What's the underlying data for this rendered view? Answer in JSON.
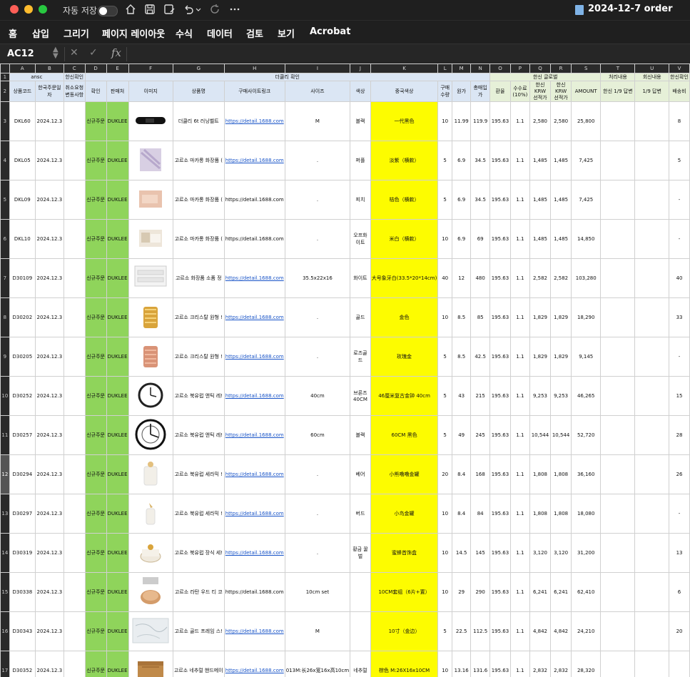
{
  "titlebar": {
    "autosave_label": "자동 저장",
    "doc_title": "2024-12-7 order",
    "chevron": "⌄"
  },
  "menu": [
    "홈",
    "삽입",
    "그리기",
    "페이지 레이아웃",
    "수식",
    "데이터",
    "검토",
    "보기",
    "Acrobat"
  ],
  "formula": {
    "cell_ref": "AC12",
    "fx_label": "fx",
    "value": ""
  },
  "columns": [
    "A",
    "B",
    "C",
    "D",
    "E",
    "F",
    "G",
    "H",
    "I",
    "J",
    "K",
    "L",
    "M",
    "N",
    "O",
    "P",
    "Q",
    "R",
    "S",
    "T",
    "U",
    "V"
  ],
  "groups": {
    "ansc": "ansc",
    "hanshin_confirm": "한신확인",
    "dukley_confirm": "더쿨리 확인",
    "hanshin_global": "한신 글로벌",
    "processing": "처리내용",
    "reply": "회신내용",
    "hanshin_confirm2": "한신확인"
  },
  "headers": {
    "A": "상품코드",
    "B": "한국주문일자",
    "C": "취소요청\n변동사항",
    "D": "확인",
    "E": "판매처",
    "F": "이미지",
    "G": "상품명",
    "H": "구매사이트링크",
    "I": "사이즈",
    "J": "색상",
    "K": "중국색상",
    "L": "구매\n수량",
    "M": "원가",
    "N": "총매입가",
    "O": "환율",
    "P": "수수료\n(10%)",
    "Q": "한신KRW\n선적가",
    "R": "한신KRW\n선적가",
    "S": "AMOUNT",
    "T": "한신 1/9 답변",
    "U": "1/9 답변",
    "V": "배송비"
  },
  "rows": [
    {
      "num": "3",
      "code": "DKL60",
      "date": "2024.12.3",
      "confirm": "신규주문",
      "seller": "DUKLEE",
      "name": "더쿨리 6t 러닝벨트",
      "link": "https://detail.1688.com",
      "size": "M",
      "color": "블랙",
      "cn_color": "一代黑色",
      "qty": "10",
      "cost": "11.99",
      "total": "119.9",
      "rate": "195.63",
      "fee": "1.1",
      "krw1": "2,580",
      "krw2": "2,580",
      "amount": "25,800",
      "ship": "8",
      "link_u": true,
      "thumb": "belt"
    },
    {
      "num": "4",
      "code": "DKL05",
      "date": "2024.12.3",
      "confirm": "신규주문",
      "seller": "DUKLEE",
      "name": "고르소 마카롱 화장품 (",
      "link": "https://detail.1688.com",
      "size": ".",
      "color": "퍼플",
      "cn_color": "淡紫（横款）",
      "qty": "5",
      "cost": "6.9",
      "total": "34.5",
      "rate": "195.63",
      "fee": "1.1",
      "krw1": "1,485",
      "krw2": "1,485",
      "amount": "7,425",
      "ship": "5",
      "link_u": true,
      "thumb": "pouch-purple"
    },
    {
      "num": "5",
      "code": "DKL09",
      "date": "2024.12.3",
      "confirm": "신규주문",
      "seller": "DUKLEE",
      "name": "고르소 마카롱 화장품 (",
      "link": "https://detail.1688.com",
      "size": ".",
      "color": "피치",
      "cn_color": "桔色（横款）",
      "qty": "5",
      "cost": "6.9",
      "total": "34.5",
      "rate": "195.63",
      "fee": "1.1",
      "krw1": "1,485",
      "krw2": "1,485",
      "amount": "7,425",
      "ship": "-",
      "link_u": false,
      "thumb": "pouch-peach"
    },
    {
      "num": "6",
      "code": "DKL10",
      "date": "2024.12.3",
      "confirm": "신규주문",
      "seller": "DUKLEE",
      "name": "고르소 마카롱 화장품 (",
      "link": "https://detail.1688.com",
      "size": ".",
      "color": "오프화이트",
      "cn_color": "米白（横款）",
      "qty": "10",
      "cost": "6.9",
      "total": "69",
      "rate": "195.63",
      "fee": "1.1",
      "krw1": "1,485",
      "krw2": "1,485",
      "amount": "14,850",
      "ship": "-",
      "link_u": false,
      "thumb": "pouch-white"
    },
    {
      "num": "7",
      "code": "D30109",
      "date": "2024.12.3",
      "confirm": "신규주문",
      "seller": "DUKLEE",
      "name": "고르소 화장품 소품 정",
      "link": "https://detail.1688.com",
      "size": "35.5x22x16",
      "color": "화이트",
      "cn_color": "大号象牙白(33.5*20*14cm)",
      "qty": "40",
      "cost": "12",
      "total": "480",
      "rate": "195.63",
      "fee": "1.1",
      "krw1": "2,582",
      "krw2": "2,582",
      "amount": "103,280",
      "ship": "40",
      "link_u": true,
      "thumb": "organizer"
    },
    {
      "num": "8",
      "code": "D30202",
      "date": "2024.12.3",
      "confirm": "신규주문",
      "seller": "DUKLEE",
      "name": "고르소 크리스탈 원형 !",
      "link": "https://detail.1688.com",
      "size": ".",
      "color": "골드",
      "cn_color": "金色",
      "qty": "10",
      "cost": "8.5",
      "total": "85",
      "rate": "195.63",
      "fee": "1.1",
      "krw1": "1,829",
      "krw2": "1,829",
      "amount": "18,290",
      "ship": "33",
      "link_u": true,
      "thumb": "crystal-gold"
    },
    {
      "num": "9",
      "code": "D30205",
      "date": "2024.12.3",
      "confirm": "신규주문",
      "seller": "DUKLEE",
      "name": "고르소 크리스탈 원형 !",
      "link": "https://detail.1688.com",
      "size": ".",
      "color": "로즈골드",
      "cn_color": "玫瑰金",
      "qty": "5",
      "cost": "8.5",
      "total": "42.5",
      "rate": "195.63",
      "fee": "1.1",
      "krw1": "1,829",
      "krw2": "1,829",
      "amount": "9,145",
      "ship": "-",
      "link_u": true,
      "thumb": "crystal-rose"
    },
    {
      "num": "10",
      "code": "D30252",
      "date": "2024.12.3",
      "confirm": "신규주문",
      "seller": "DUKLEE",
      "name": "고르소 북유럽 앤틱 레!",
      "link": "https://detail.1688.com",
      "size": "40cm",
      "color": "브론즈\n40CM",
      "cn_color": "46厘米复古金钟 40cm",
      "qty": "5",
      "cost": "43",
      "total": "215",
      "rate": "195.63",
      "fee": "1.1",
      "krw1": "9,253",
      "krw2": "9,253",
      "amount": "46,265",
      "ship": "15",
      "link_u": true,
      "thumb": "clock"
    },
    {
      "num": "11",
      "code": "D30257",
      "date": "2024.12.3",
      "confirm": "신규주문",
      "seller": "DUKLEE",
      "name": "고르소 북유럽 앤틱 레!",
      "link": "https://detail.1688.com",
      "size": "60cm",
      "color": "블랙",
      "cn_color": "60CM 黑色",
      "qty": "5",
      "cost": "49",
      "total": "245",
      "rate": "195.63",
      "fee": "1.1",
      "krw1": "10,544",
      "krw2": "10,544",
      "amount": "52,720",
      "ship": "28",
      "link_u": true,
      "thumb": "clock2"
    },
    {
      "num": "12",
      "code": "D30294",
      "date": "2024.12.3",
      "confirm": "신규주문",
      "seller": "DUKLEE",
      "name": "고르소 북유럽 세라믹 !",
      "link": "https://detail.1688.com",
      "size": ".",
      "color": "베어",
      "cn_color": "小熊噜噜金罐",
      "qty": "20",
      "cost": "8.4",
      "total": "168",
      "rate": "195.63",
      "fee": "1.1",
      "krw1": "1,808",
      "krw2": "1,808",
      "amount": "36,160",
      "ship": "26",
      "link_u": true,
      "thumb": "ceramic-bear",
      "selected": true
    },
    {
      "num": "13",
      "code": "D30297",
      "date": "2024.12.3",
      "confirm": "신규주문",
      "seller": "DUKLEE",
      "name": "고르소 북유럽 세라믹 !",
      "link": "https://detail.1688.com",
      "size": ".",
      "color": "버드",
      "cn_color": "小鸟金罐",
      "qty": "10",
      "cost": "8.4",
      "total": "84",
      "rate": "195.63",
      "fee": "1.1",
      "krw1": "1,808",
      "krw2": "1,808",
      "amount": "18,080",
      "ship": "-",
      "link_u": true,
      "thumb": "ceramic-bird"
    },
    {
      "num": "14",
      "code": "D30319",
      "date": "2024.12.3",
      "confirm": "신규주문",
      "seller": "DUKLEE",
      "name": "고르소 북유럽 장식 세!",
      "link": "https://detail.1688.com",
      "size": ".",
      "color": "황금 꿀벌",
      "cn_color": "蜜蜂首饰盒",
      "qty": "10",
      "cost": "14.5",
      "total": "145",
      "rate": "195.63",
      "fee": "1.1",
      "krw1": "3,120",
      "krw2": "3,120",
      "amount": "31,200",
      "ship": "13",
      "link_u": true,
      "thumb": "bee-box"
    },
    {
      "num": "15",
      "code": "D30338",
      "date": "2024.12.3",
      "confirm": "신규주문",
      "seller": "DUKLEE",
      "name": "고르소 라탄 우드 티 코",
      "link": "https://detail.1688.com",
      "size": "10cm set",
      "color": "",
      "cn_color": "10CM套组（6片+置）",
      "qty": "10",
      "cost": "29",
      "total": "290",
      "rate": "195.63",
      "fee": "1.1",
      "krw1": "6,241",
      "krw2": "6,241",
      "amount": "62,410",
      "ship": "6",
      "link_u": false,
      "thumb": "coaster"
    },
    {
      "num": "16",
      "code": "D30343",
      "date": "2024.12.3",
      "confirm": "신규주문",
      "seller": "DUKLEE",
      "name": "고르소 골드 프레임 스!",
      "link": "https://detail.1688.com",
      "size": "M",
      "color": "",
      "cn_color": "10寸（金边）",
      "qty": "5",
      "cost": "22.5",
      "total": "112.5",
      "rate": "195.63",
      "fee": "1.1",
      "krw1": "4,842",
      "krw2": "4,842",
      "amount": "24,210",
      "ship": "20",
      "link_u": true,
      "thumb": "marble"
    },
    {
      "num": "17",
      "code": "D30352",
      "date": "2024.12.3",
      "confirm": "신규주문",
      "seller": "DUKLEE",
      "name": "고르소 네추럴 핸드메이",
      "link": "https://detail.1688.com",
      "size": "013M:长26x宽16x高10cm",
      "color": "네추럴",
      "cn_color": "棕色 M:26X16x10CM",
      "qty": "10",
      "cost": "13.16",
      "total": "131.6",
      "rate": "195.63",
      "fee": "1.1",
      "krw1": "2,832",
      "krw2": "2,832",
      "amount": "28,320",
      "ship": "",
      "link_u": true,
      "thumb": "wood-box"
    }
  ]
}
